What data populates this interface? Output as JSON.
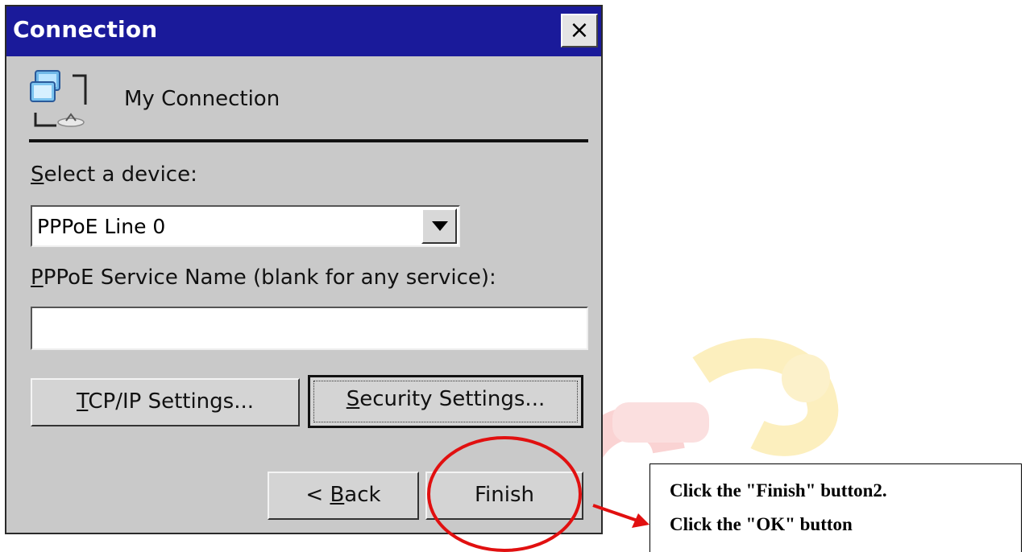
{
  "dialog": {
    "title": "Connection",
    "close_label": "×",
    "connection_icon": "network-computer-icon",
    "connection_name": "My Connection",
    "device_label_prefix": "S",
    "device_label_rest": "elect a device:",
    "device_selected": "PPPoE Line 0",
    "service_label_prefix": "P",
    "service_label_rest": "PPoE Service Name (blank for any service):",
    "service_value": "",
    "tcpip_button_prefix": "T",
    "tcpip_button_rest": "CP/IP Settings...",
    "security_button_prefix": "S",
    "security_button_rest": "ecurity Settings...",
    "back_button_pre": "< ",
    "back_button_key": "B",
    "back_button_rest": "ack",
    "finish_button": "Finish"
  },
  "annotation": {
    "line1": "Click the \"Finish\" button2.",
    "line2": "Click the \"OK\" button",
    "highlight_color": "#e11010",
    "arrow_color": "#e11010"
  },
  "colors": {
    "titlebar": "#1a1a9a",
    "dialog_bg": "#c9c9c9"
  }
}
